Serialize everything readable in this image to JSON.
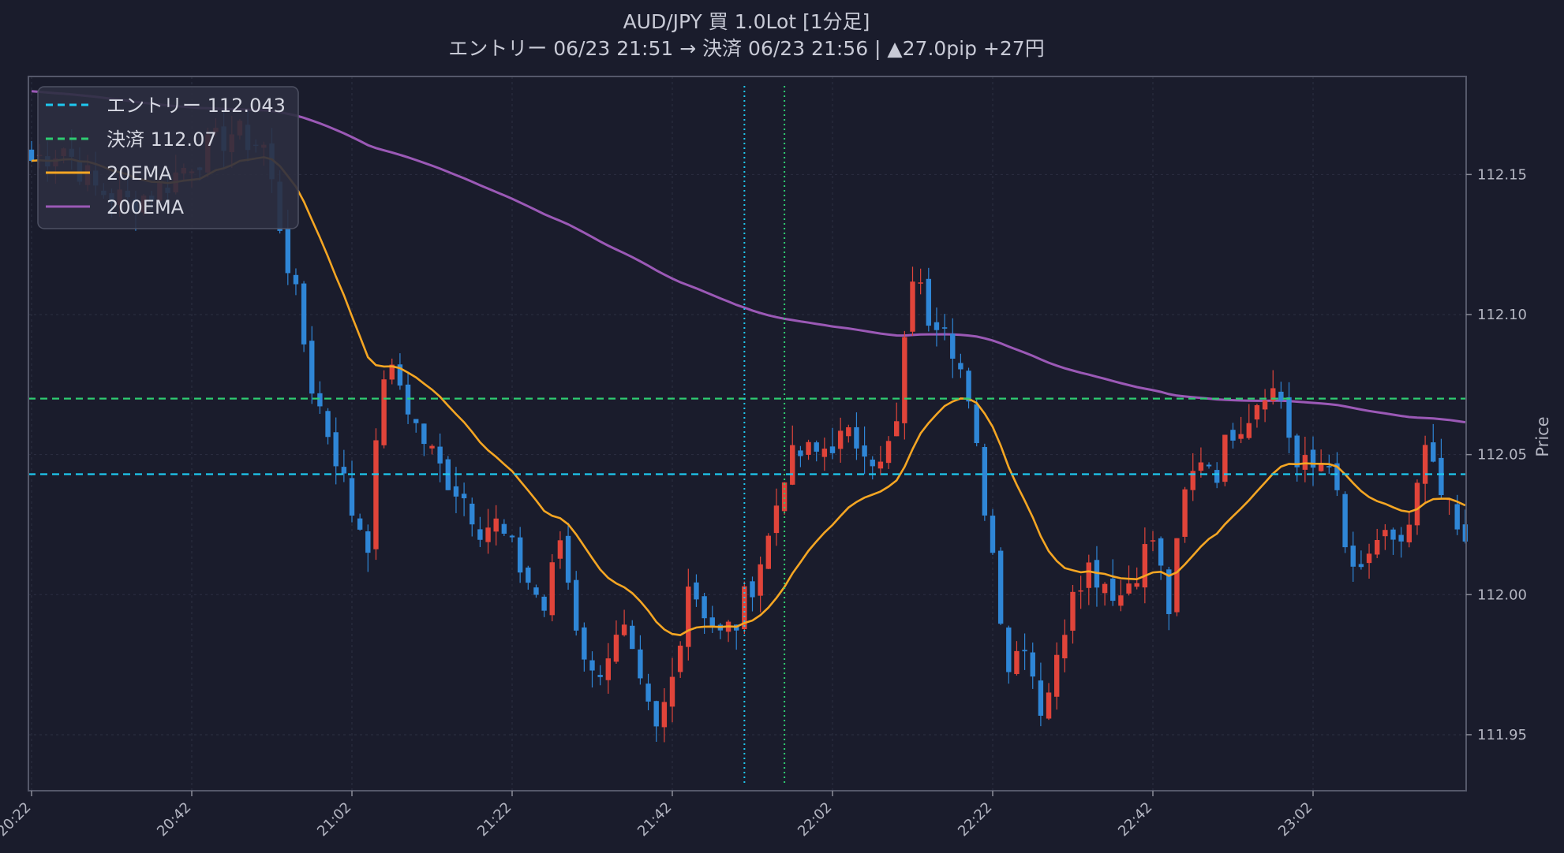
{
  "title": {
    "line1": "AUD/JPY 買 1.0Lot [1分足]",
    "line2": "エントリー 06/23 21:51 → 決済 06/23 21:56 | ▲27.0pip +27円"
  },
  "colors": {
    "background": "#1a1c2c",
    "plot_border": "#4a4c5a",
    "grid": "#2c2f42",
    "up": "#e0443a",
    "down": "#2f86d6",
    "entry_line": "#1ec8f0",
    "exit_line": "#2ecc71",
    "ema20": "#f5a623",
    "ema200": "#9b59b6"
  },
  "chart_data": {
    "type": "candlestick",
    "ylabel": "Price",
    "ylim": [
      111.93,
      112.185
    ],
    "y_ticks": [
      "111.95",
      "112.00",
      "112.05",
      "112.10",
      "112.15"
    ],
    "x_ticks": [
      "20:22",
      "20:42",
      "21:02",
      "21:22",
      "21:42",
      "22:02",
      "22:22",
      "22:42",
      "23:02"
    ],
    "x_start_minute": "20:22",
    "n_candles": 180,
    "grid": true,
    "legend_position": "top-left",
    "legend": [
      {
        "label": "エントリー 112.043",
        "style": "dashed",
        "color": "#1ec8f0"
      },
      {
        "label": "決済 112.07",
        "style": "dashed",
        "color": "#2ecc71"
      },
      {
        "label": "20EMA",
        "style": "solid",
        "color": "#f5a623"
      },
      {
        "label": "200EMA",
        "style": "solid",
        "color": "#9b59b6"
      }
    ],
    "entry_price": 112.043,
    "exit_price": 112.07,
    "entry_time": "21:51",
    "exit_time": "21:56",
    "close_keypoints": [
      {
        "t": 0,
        "p": 112.155
      },
      {
        "t": 4,
        "p": 112.16
      },
      {
        "t": 8,
        "p": 112.145
      },
      {
        "t": 12,
        "p": 112.14
      },
      {
        "t": 16,
        "p": 112.145
      },
      {
        "t": 20,
        "p": 112.155
      },
      {
        "t": 25,
        "p": 112.165
      },
      {
        "t": 29,
        "p": 112.16
      },
      {
        "t": 33,
        "p": 112.105
      },
      {
        "t": 35,
        "p": 112.075
      },
      {
        "t": 38,
        "p": 112.05
      },
      {
        "t": 40,
        "p": 112.03
      },
      {
        "t": 42,
        "p": 112.02
      },
      {
        "t": 44,
        "p": 112.08
      },
      {
        "t": 46,
        "p": 112.075
      },
      {
        "t": 48,
        "p": 112.06
      },
      {
        "t": 51,
        "p": 112.045
      },
      {
        "t": 54,
        "p": 112.035
      },
      {
        "t": 56,
        "p": 112.025
      },
      {
        "t": 58,
        "p": 112.025
      },
      {
        "t": 60,
        "p": 112.015
      },
      {
        "t": 62,
        "p": 112.005
      },
      {
        "t": 64,
        "p": 111.995
      },
      {
        "t": 66,
        "p": 112.02
      },
      {
        "t": 68,
        "p": 111.99
      },
      {
        "t": 70,
        "p": 111.97
      },
      {
        "t": 72,
        "p": 111.98
      },
      {
        "t": 74,
        "p": 111.985
      },
      {
        "t": 76,
        "p": 111.965
      },
      {
        "t": 78,
        "p": 111.95
      },
      {
        "t": 80,
        "p": 111.97
      },
      {
        "t": 82,
        "p": 112.005
      },
      {
        "t": 84,
        "p": 111.995
      },
      {
        "t": 86,
        "p": 111.985
      },
      {
        "t": 88,
        "p": 111.99
      },
      {
        "t": 90,
        "p": 112.005
      },
      {
        "t": 92,
        "p": 112.02
      },
      {
        "t": 94,
        "p": 112.045
      },
      {
        "t": 96,
        "p": 112.05
      },
      {
        "t": 98,
        "p": 112.05
      },
      {
        "t": 100,
        "p": 112.055
      },
      {
        "t": 102,
        "p": 112.055
      },
      {
        "t": 104,
        "p": 112.055
      },
      {
        "t": 106,
        "p": 112.045
      },
      {
        "t": 108,
        "p": 112.06
      },
      {
        "t": 110,
        "p": 112.115
      },
      {
        "t": 112,
        "p": 112.1
      },
      {
        "t": 114,
        "p": 112.1
      },
      {
        "t": 116,
        "p": 112.08
      },
      {
        "t": 118,
        "p": 112.05
      },
      {
        "t": 120,
        "p": 112.015
      },
      {
        "t": 122,
        "p": 111.975
      },
      {
        "t": 124,
        "p": 111.985
      },
      {
        "t": 126,
        "p": 111.96
      },
      {
        "t": 128,
        "p": 111.975
      },
      {
        "t": 130,
        "p": 112.005
      },
      {
        "t": 132,
        "p": 112.01
      },
      {
        "t": 134,
        "p": 112.005
      },
      {
        "t": 136,
        "p": 112.0
      },
      {
        "t": 138,
        "p": 112.01
      },
      {
        "t": 140,
        "p": 112.02
      },
      {
        "t": 142,
        "p": 111.995
      },
      {
        "t": 144,
        "p": 112.035
      },
      {
        "t": 146,
        "p": 112.05
      },
      {
        "t": 148,
        "p": 112.045
      },
      {
        "t": 150,
        "p": 112.06
      },
      {
        "t": 152,
        "p": 112.065
      },
      {
        "t": 154,
        "p": 112.075
      },
      {
        "t": 156,
        "p": 112.07
      },
      {
        "t": 158,
        "p": 112.045
      },
      {
        "t": 160,
        "p": 112.045
      },
      {
        "t": 162,
        "p": 112.05
      },
      {
        "t": 164,
        "p": 112.015
      },
      {
        "t": 166,
        "p": 112.005
      },
      {
        "t": 168,
        "p": 112.02
      },
      {
        "t": 170,
        "p": 112.015
      },
      {
        "t": 172,
        "p": 112.025
      },
      {
        "t": 174,
        "p": 112.05
      },
      {
        "t": 176,
        "p": 112.035
      },
      {
        "t": 179,
        "p": 112.015
      }
    ]
  }
}
